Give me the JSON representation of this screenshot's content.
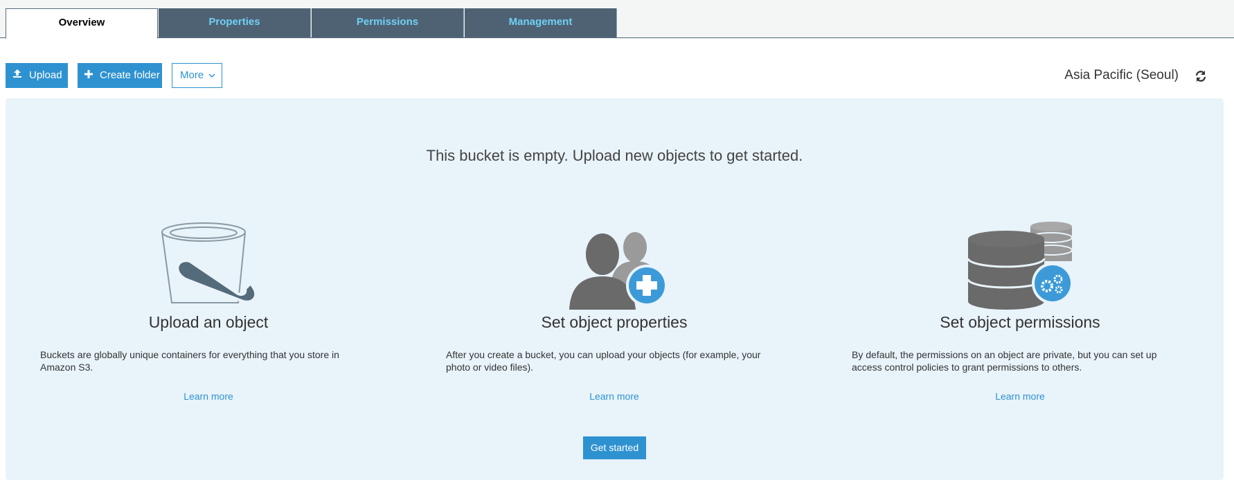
{
  "tabs": [
    {
      "label": "Overview",
      "active": true
    },
    {
      "label": "Properties",
      "active": false
    },
    {
      "label": "Permissions",
      "active": false
    },
    {
      "label": "Management",
      "active": false
    }
  ],
  "toolbar": {
    "upload_label": "Upload",
    "create_folder_label": "Create folder",
    "more_label": "More",
    "region": "Asia Pacific (Seoul)"
  },
  "empty_state": {
    "headline": "This bucket is empty. Upload new objects to get started.",
    "columns": [
      {
        "icon": "bucket-upload-icon",
        "title": "Upload an object",
        "description": "Buckets are globally unique containers for everything that you store in Amazon S3.",
        "link": "Learn more"
      },
      {
        "icon": "users-add-icon",
        "title": "Set object properties",
        "description": "After you create a bucket, you can upload your objects (for example, your photo or video files).",
        "link": "Learn more"
      },
      {
        "icon": "database-settings-icon",
        "title": "Set object permissions",
        "description": "By default, the permissions on an object are private, but you can set up access control policies to grant permissions to others.",
        "link": "Learn more"
      }
    ],
    "cta": "Get started"
  },
  "colors": {
    "primary": "#2e92d1",
    "tab_dark": "#4f6273",
    "tab_text": "#6fd0f5",
    "panel_bg": "#e8f3fa"
  }
}
